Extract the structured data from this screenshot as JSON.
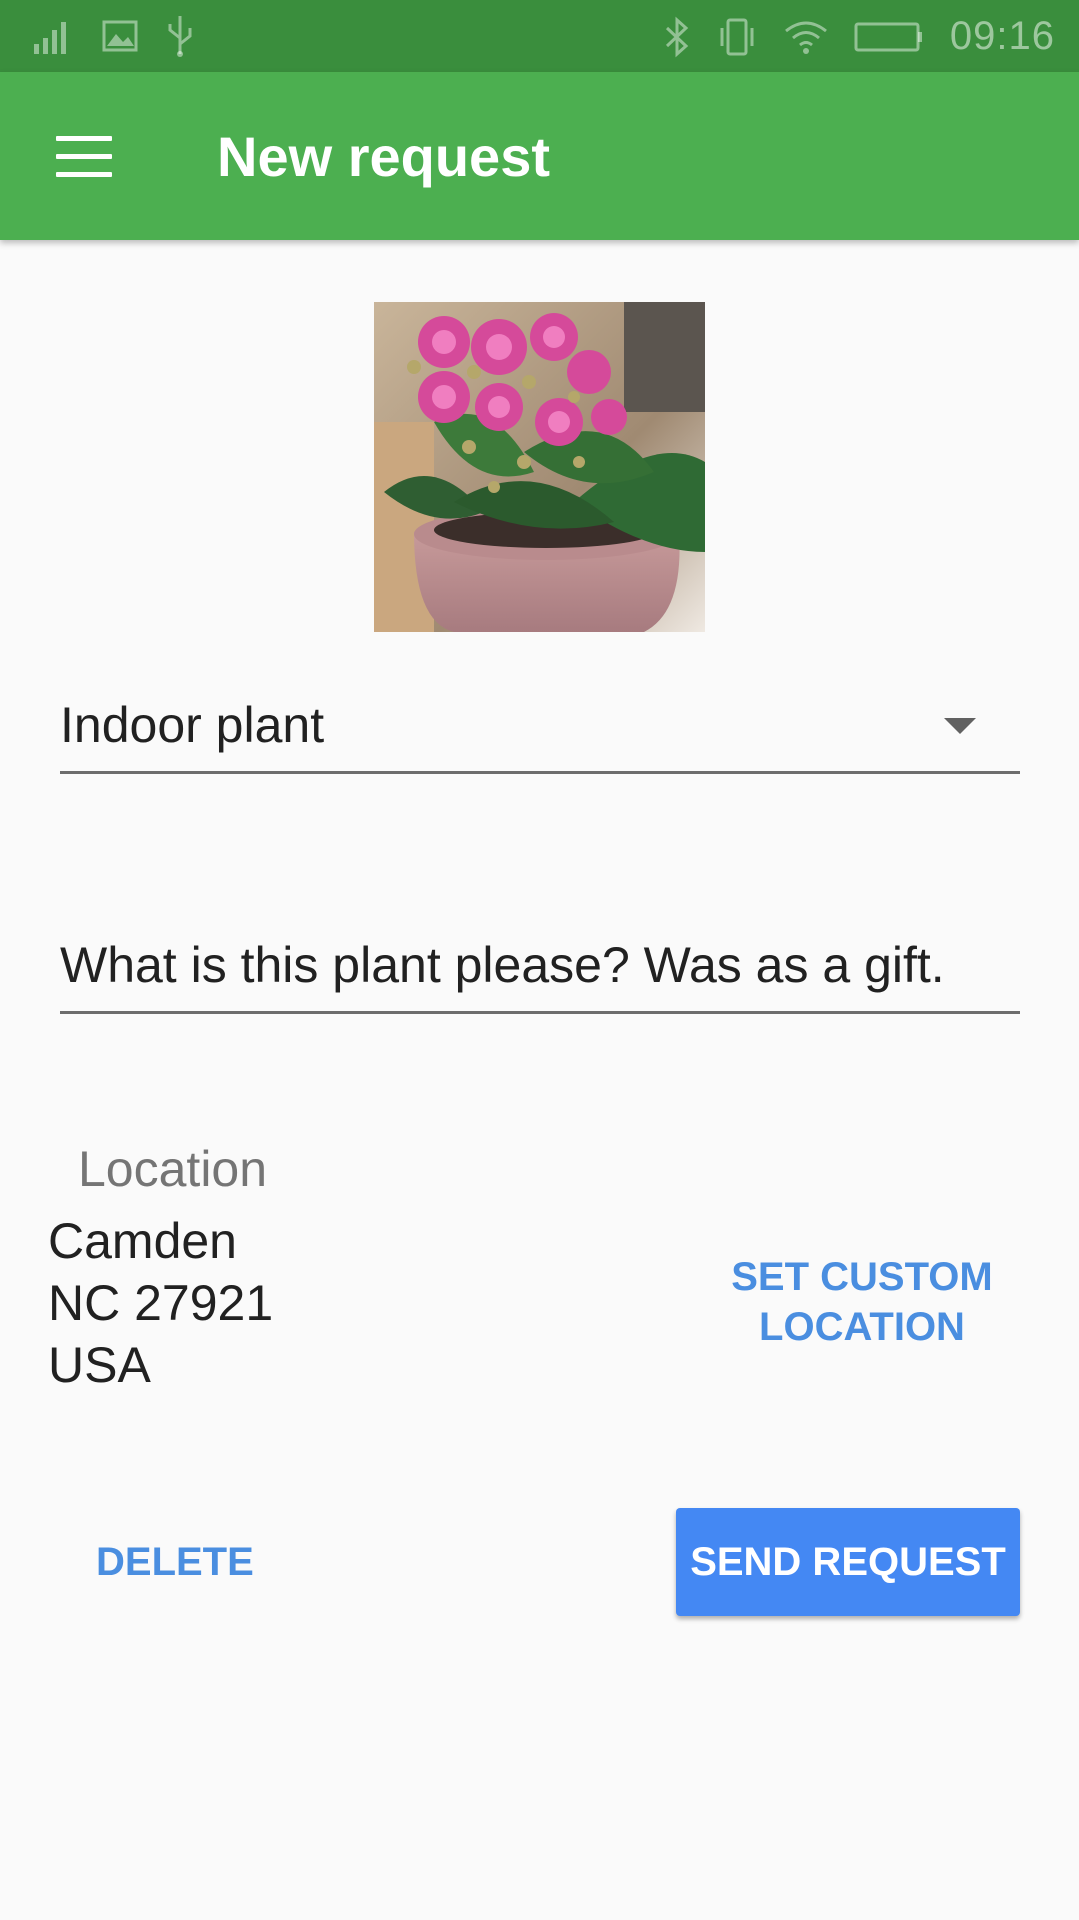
{
  "status_bar": {
    "time": "09:16",
    "icons": [
      "signal-icon",
      "image-icon",
      "usb-icon",
      "bluetooth-icon",
      "vibrate-icon",
      "wifi-icon",
      "battery-icon"
    ]
  },
  "app_bar": {
    "title": "New request",
    "menu_icon": "menu-icon",
    "color": "#4caf50",
    "status_color": "#3a8e3d"
  },
  "form": {
    "photo_description": "plant-photo",
    "category_value": "Indoor plant",
    "question_value": "What is this plant please? Was as a gift.",
    "location": {
      "label": "Location",
      "line1": "Camden",
      "line2": "NC 27921",
      "line3": "USA",
      "custom_button": "SET CUSTOM LOCATION"
    }
  },
  "actions": {
    "delete_label": "DELETE",
    "send_label": "SEND REQUEST",
    "accent_color": "#4488f3"
  }
}
